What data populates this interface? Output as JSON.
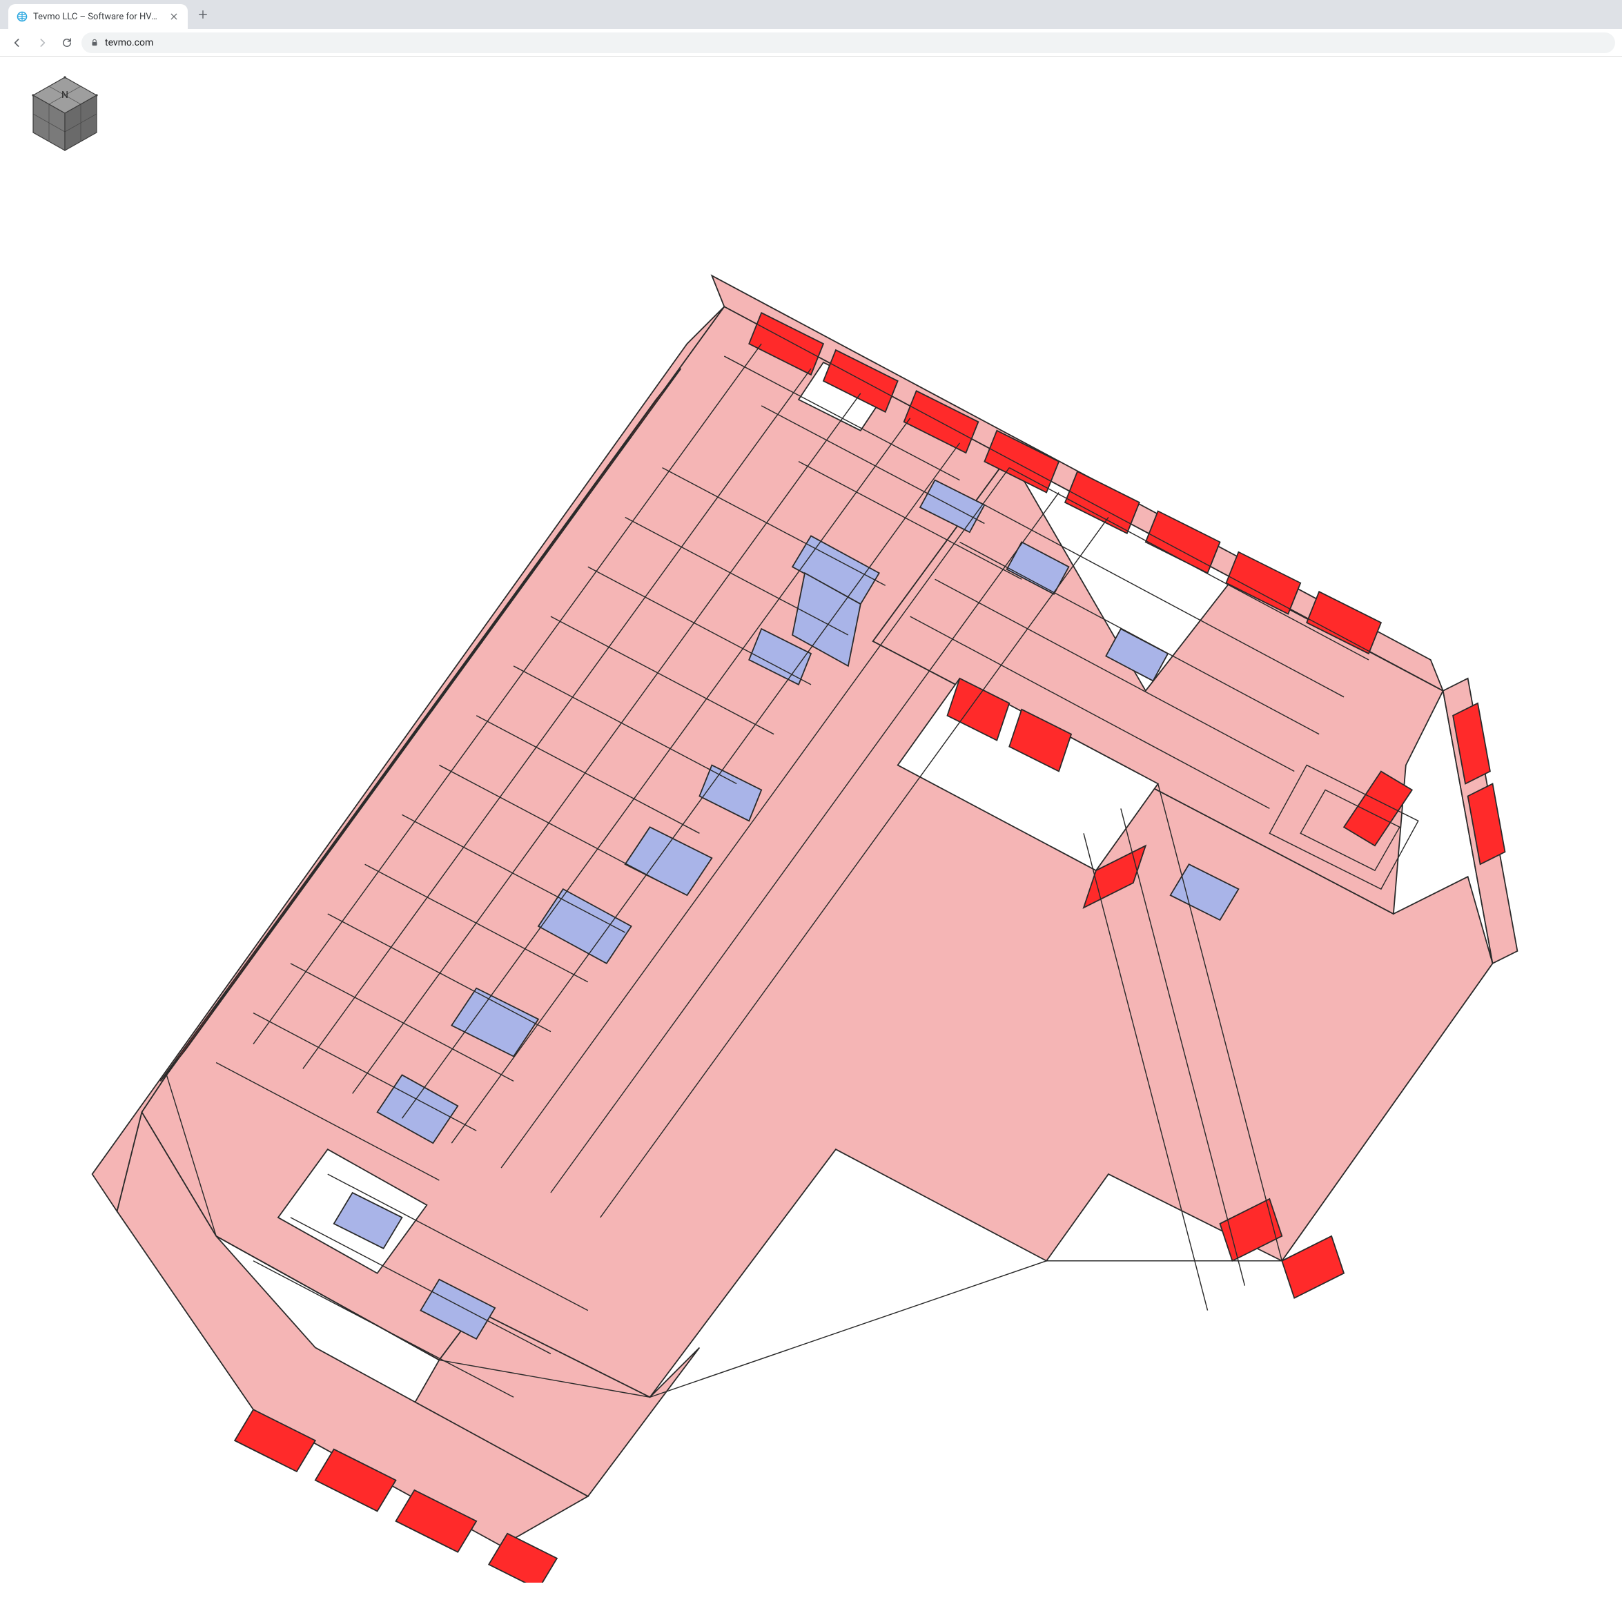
{
  "browser": {
    "tab_title": "Tevmo LLC – Software for HVACR",
    "url_display": "tevmo.com"
  },
  "viewer": {
    "viewcube": {
      "faces": {
        "top": "N"
      }
    },
    "model": {
      "description": "3D isometric building floor-plan model",
      "colors": {
        "floor_fill": "#f5b5b5",
        "window_panel": "#ff2a2a",
        "interior_block": "#a9b4e8",
        "edge_stroke": "#2a2a2a"
      }
    }
  }
}
